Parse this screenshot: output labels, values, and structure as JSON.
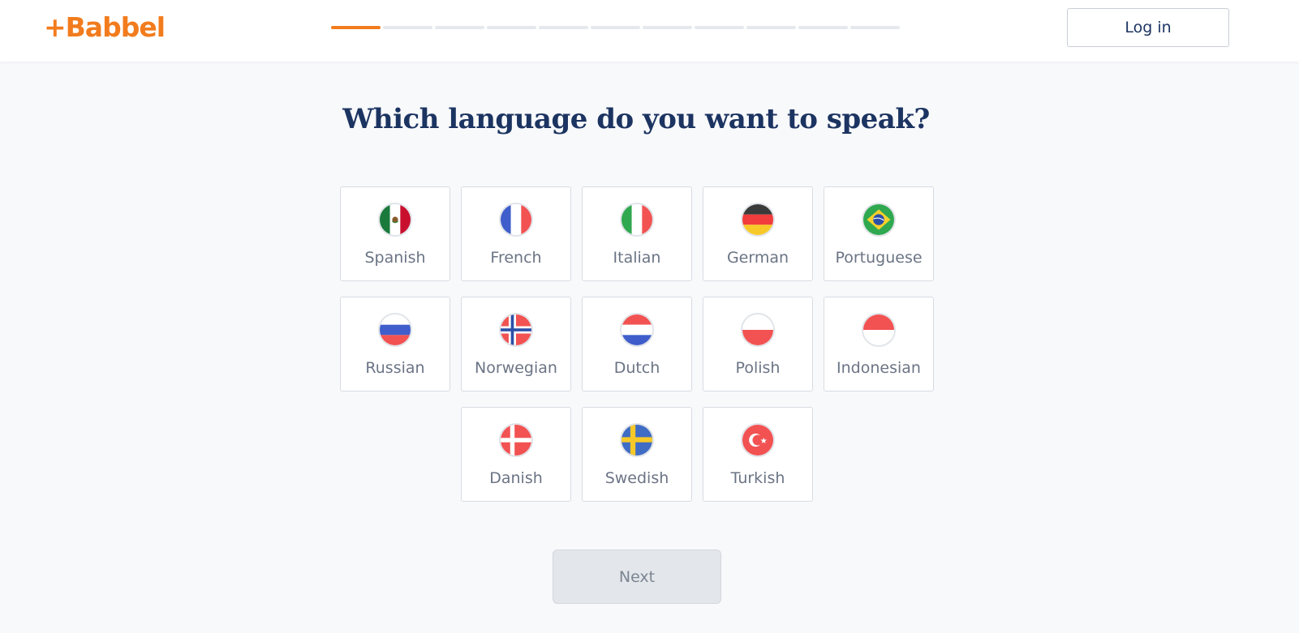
{
  "header": {
    "logo_text": "+Babbel",
    "progress": {
      "steps_total": 11,
      "current_step": 1
    },
    "login_label": "Log in"
  },
  "main": {
    "title": "Which language do you want to speak?",
    "languages": [
      {
        "label": "Spanish",
        "flag_icon": "mexico-flag-icon"
      },
      {
        "label": "French",
        "flag_icon": "france-flag-icon"
      },
      {
        "label": "Italian",
        "flag_icon": "italy-flag-icon"
      },
      {
        "label": "German",
        "flag_icon": "germany-flag-icon"
      },
      {
        "label": "Portuguese",
        "flag_icon": "brazil-flag-icon"
      },
      {
        "label": "Russian",
        "flag_icon": "russia-flag-icon"
      },
      {
        "label": "Norwegian",
        "flag_icon": "norway-flag-icon"
      },
      {
        "label": "Dutch",
        "flag_icon": "netherlands-flag-icon"
      },
      {
        "label": "Polish",
        "flag_icon": "poland-flag-icon"
      },
      {
        "label": "Indonesian",
        "flag_icon": "indonesia-flag-icon"
      },
      {
        "label": "Danish",
        "flag_icon": "denmark-flag-icon"
      },
      {
        "label": "Swedish",
        "flag_icon": "sweden-flag-icon"
      },
      {
        "label": "Turkish",
        "flag_icon": "turkey-flag-icon"
      }
    ],
    "next_label": "Next"
  },
  "colors": {
    "brand_orange": "#f27c1d",
    "navy": "#1c3461",
    "text_gray": "#6b7485",
    "page_bg": "#f8f9fb"
  }
}
